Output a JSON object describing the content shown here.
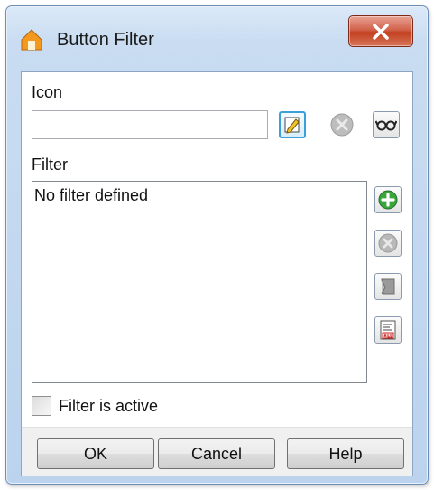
{
  "window": {
    "title": "Button Filter"
  },
  "icon_section": {
    "label": "Icon",
    "value": "",
    "placeholder": ""
  },
  "filter_section": {
    "label": "Filter",
    "items": [
      "No filter defined"
    ]
  },
  "active_checkbox": {
    "label": "Filter is active",
    "checked": false
  },
  "buttons": {
    "ok": "OK",
    "cancel": "Cancel",
    "help": "Help"
  },
  "icons": {
    "app": "house-icon",
    "close": "close-icon",
    "edit": "edit-icon",
    "remove": "remove-icon",
    "preview": "glasses-icon",
    "add": "add-icon",
    "delete": "delete-icon",
    "edit_filter": "edit-filter-icon",
    "formula": "formula-icon"
  },
  "colors": {
    "accent": "#3c9fd8",
    "add_green": "#3aa53a",
    "close_red": "#c2401f"
  }
}
